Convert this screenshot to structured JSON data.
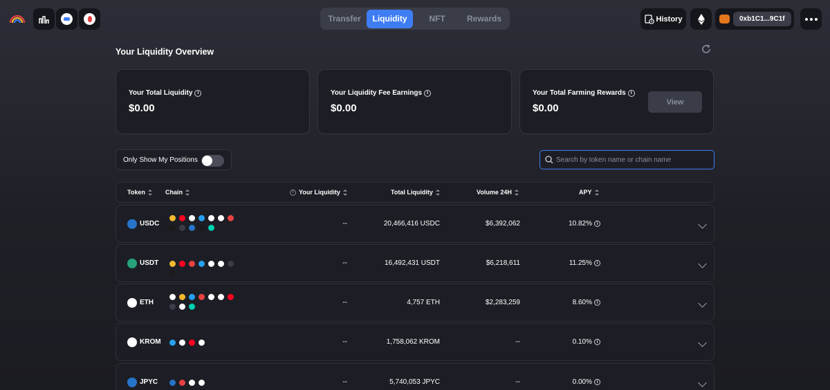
{
  "nav": {
    "tabs": [
      {
        "label": "Transfer",
        "active": false
      },
      {
        "label": "Liquidity",
        "active": true
      },
      {
        "label": "NFT",
        "active": false
      },
      {
        "label": "Rewards",
        "active": false
      }
    ]
  },
  "header": {
    "history_label": "History",
    "wallet_address": "0xb1C1...9C1f"
  },
  "overview": {
    "title": "Your Liquidity Overview",
    "cards": [
      {
        "label": "Your Total Liquidity",
        "value": "$0.00"
      },
      {
        "label": "Your Liquidity Fee Earnings",
        "value": "$0.00"
      },
      {
        "label": "Your Total Farming Rewards",
        "value": "$0.00",
        "button": "View"
      }
    ]
  },
  "filters": {
    "toggle_label": "Only Show My Positions",
    "toggle_on": false,
    "search_placeholder": "Search by token name or chain name"
  },
  "table": {
    "headers": {
      "token": "Token",
      "chain": "Chain",
      "your_liquidity": "Your Liquidity",
      "total_liquidity": "Total Liquidity",
      "volume": "Volume 24H",
      "apy": "APY"
    },
    "rows": [
      {
        "token": "USDC",
        "icon_color": "#2775ca",
        "your_liquidity": "--",
        "total_liquidity": "20,466,416 USDC",
        "volume": "$6,392,062",
        "apy": "10.82%",
        "chains": [
          "#f3ba2f",
          "#ff0420",
          "#ffffff",
          "#28a0f0",
          "#ffffff",
          "#ffffff",
          "#e84142",
          "#1b1b1b",
          "#3a3d48",
          "#2775ca",
          "#1b1b1b",
          "#00d1b2"
        ]
      },
      {
        "token": "USDT",
        "icon_color": "#26a17b",
        "your_liquidity": "--",
        "total_liquidity": "16,492,431 USDT",
        "volume": "$6,218,611",
        "apy": "11.25%",
        "chains": [
          "#f3ba2f",
          "#ff0420",
          "#e84142",
          "#28a0f0",
          "#ffffff",
          "#ffffff",
          "#3a3d48",
          "#1b1b1b"
        ]
      },
      {
        "token": "ETH",
        "icon_color": "#ffffff",
        "your_liquidity": "--",
        "total_liquidity": "4,757 ETH",
        "volume": "$2,283,259",
        "apy": "8.60%",
        "chains": [
          "#ffffff",
          "#f3ba2f",
          "#28a0f0",
          "#e84142",
          "#ffffff",
          "#ffffff",
          "#ff0420",
          "#3a3d48",
          "#ffffff",
          "#00d1b2"
        ]
      },
      {
        "token": "KROM",
        "icon_color": "#ffffff",
        "your_liquidity": "--",
        "total_liquidity": "1,758,062 KROM",
        "volume": "--",
        "apy": "0.10%",
        "chains": [
          "#28a0f0",
          "#ffffff",
          "#ff0420",
          "#ffffff"
        ]
      },
      {
        "token": "JPYC",
        "icon_color": "#2775ca",
        "your_liquidity": "--",
        "total_liquidity": "5,740,053 JPYC",
        "volume": "--",
        "apy": "0.00%",
        "chains": [
          "#2775ca",
          "#e84142",
          "#ffffff",
          "#ffffff"
        ]
      }
    ]
  },
  "icons": [
    "rainbow-logo",
    "chart-icon",
    "avatar-icon",
    "flame-icon",
    "history-icon",
    "ethereum-icon",
    "fox-icon",
    "more-icon",
    "refresh-icon",
    "search-icon",
    "info-icon",
    "chevron-down-icon"
  ]
}
